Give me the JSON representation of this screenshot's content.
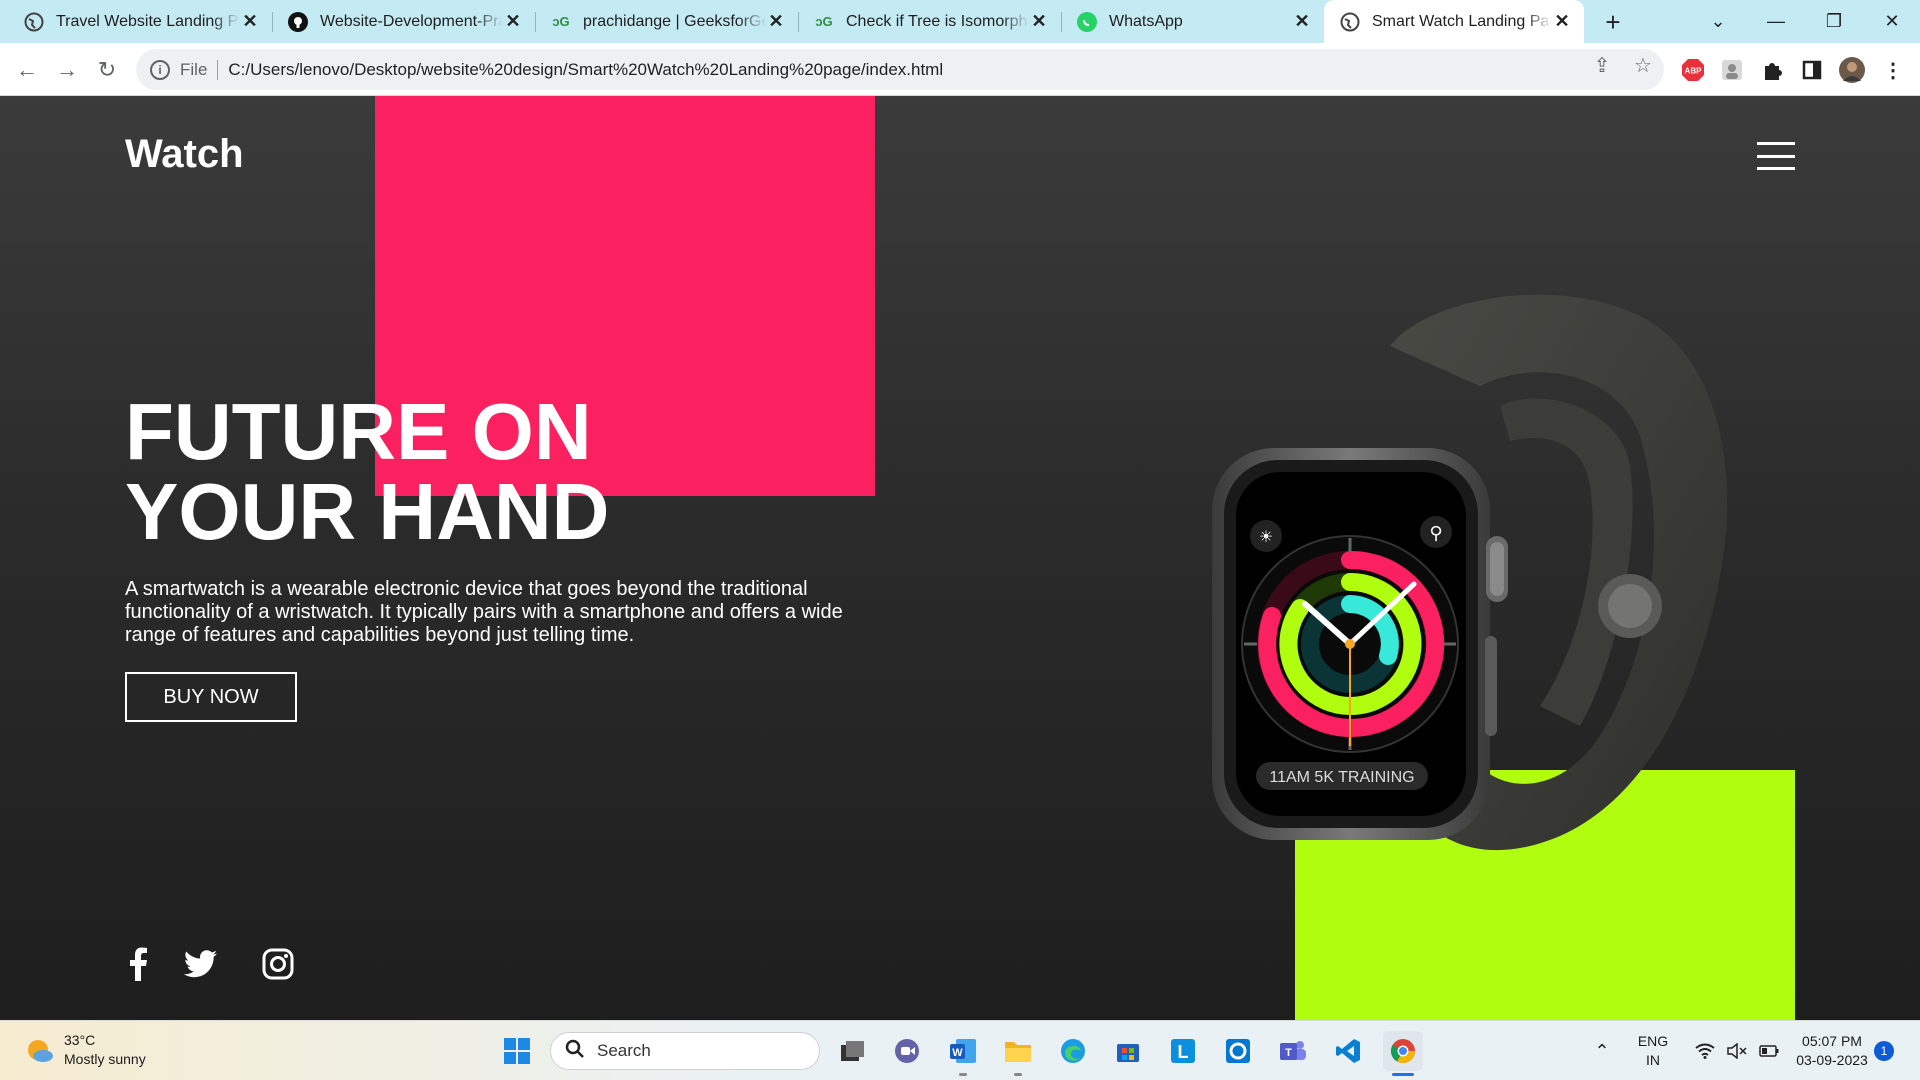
{
  "browser": {
    "tabs": [
      {
        "title": "Travel Website Landing Page",
        "icon": "globe-icon"
      },
      {
        "title": "Website-Development-Practice",
        "icon": "github-icon"
      },
      {
        "title": "prachidange | GeeksforGeeks",
        "icon": "gfg-icon"
      },
      {
        "title": "Check if Tree is Isomorphic",
        "icon": "gfg-icon"
      },
      {
        "title": "WhatsApp",
        "icon": "whatsapp-icon"
      },
      {
        "title": "Smart Watch Landing Page",
        "icon": "globe-icon",
        "active": true
      }
    ],
    "address": {
      "scheme": "File",
      "url": "C:/Users/lenovo/Desktop/website%20design/Smart%20Watch%20Landing%20page/index.html"
    },
    "extensions": [
      "abp-icon",
      "profile-ext-icon",
      "puzzle-icon",
      "sidepanel-icon",
      "avatar-icon",
      "more-icon"
    ]
  },
  "page": {
    "logo": "Watch",
    "hero_title_line1": "FUTURE ON",
    "hero_title_line2": "YOUR HAND",
    "hero_text": "A smartwatch is a wearable electronic device that goes beyond the traditional functionality of a wristwatch. It typically pairs with a smartphone and offers a wide range of features and capabilities beyond just telling time.",
    "cta_label": "BUY NOW",
    "watch_screen_text": "11AM 5K TRAINING",
    "social": [
      "facebook-icon",
      "twitter-icon",
      "instagram-icon"
    ],
    "colors": {
      "accent_pink": "#fb2160",
      "accent_lime": "#b1fd0f",
      "background": "#2a2a2a"
    }
  },
  "taskbar": {
    "weather_temp": "33°C",
    "weather_desc": "Mostly sunny",
    "search_label": "Search",
    "lang_line1": "ENG",
    "lang_line2": "IN",
    "time": "05:07 PM",
    "date": "03-09-2023",
    "notification_count": "1"
  }
}
